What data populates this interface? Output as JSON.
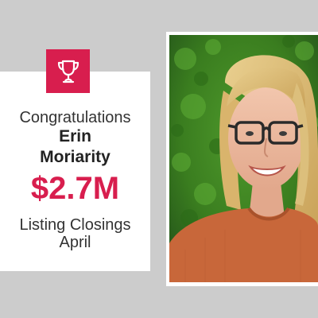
{
  "announcement": {
    "greeting": "Congratulations",
    "first_name": "Erin",
    "last_name": "Moriarity",
    "amount": "$2.7M",
    "category": "Listing Closings",
    "period": "April"
  },
  "icons": {
    "badge": "trophy-icon"
  },
  "colors": {
    "accent": "#d81e4e",
    "background": "#cccccc",
    "card": "#ffffff",
    "text": "#333333"
  }
}
